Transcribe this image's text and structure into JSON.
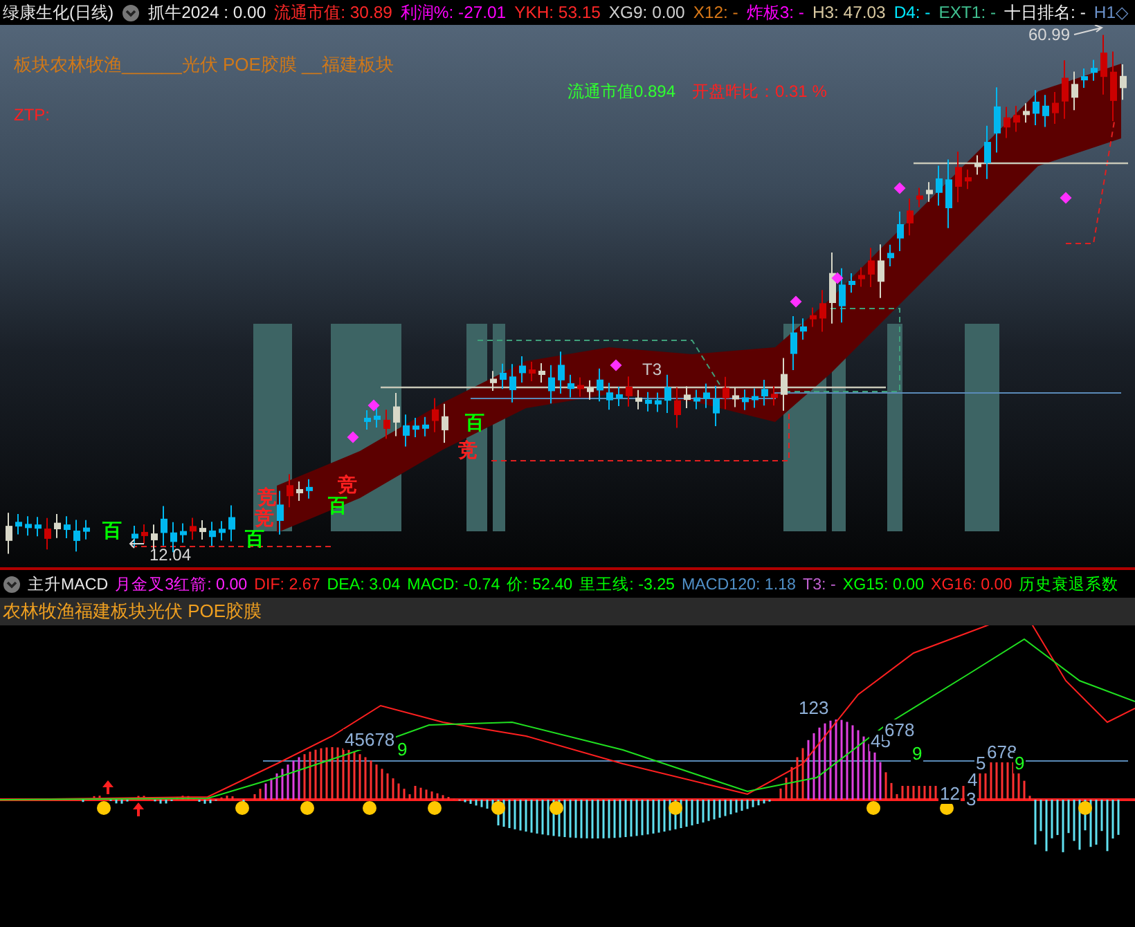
{
  "header": {
    "title": "绿康生化(日线)",
    "indicators": [
      {
        "text": "抓牛2024 : 0.00",
        "color": "#e8e8e8"
      },
      {
        "text": "流通市值: 30.89",
        "color": "#ff2828"
      },
      {
        "text": "利润%: -27.01",
        "color": "#ff00ff"
      },
      {
        "text": "YKH: 53.15",
        "color": "#ff2828"
      },
      {
        "text": "XG9: 0.00",
        "color": "#d0d0d0"
      },
      {
        "text": "X12: -",
        "color": "#d87818"
      },
      {
        "text": "炸板3: -",
        "color": "#ff00ff"
      },
      {
        "text": "H3: 47.03",
        "color": "#d8c8a0"
      },
      {
        "text": "D4: -",
        "color": "#00e8ff"
      },
      {
        "text": "EXT1: -",
        "color": "#40c090"
      },
      {
        "text": "十日排名: -",
        "color": "#f0f0f0"
      },
      {
        "text": "H1◇",
        "color": "#6a90c8"
      }
    ]
  },
  "price_chart": {
    "sector_text": "板块农林牧渔______光伏 POE胶膜 __福建板块",
    "ztp_text": "ZTP:",
    "float_cap": "流通市值0.894",
    "open_ratio": "开盘昨比：0.31 %",
    "high_label": "60.99",
    "low_label": "12.04",
    "t3_label": "T3",
    "markers": [
      {
        "text": "百",
        "color": "#00ff00"
      },
      {
        "text": "竞",
        "color": "#ff2020"
      },
      {
        "text": "竞",
        "color": "#ff2020"
      },
      {
        "text": "百",
        "color": "#00ff00"
      },
      {
        "text": "竞",
        "color": "#ff2020"
      },
      {
        "text": "百",
        "color": "#00ff00"
      },
      {
        "text": "竞",
        "color": "#ff2020"
      },
      {
        "text": "百",
        "color": "#00ff00"
      }
    ]
  },
  "macd_panel": {
    "title": "主升MACD",
    "indicators": [
      {
        "text": "月金叉3红箭: 0.00",
        "color": "#ff20ff"
      },
      {
        "text": "DIF: 2.67",
        "color": "#ff2020"
      },
      {
        "text": "DEA: 3.04",
        "color": "#00ff00"
      },
      {
        "text": "MACD: -0.74",
        "color": "#00ff00"
      },
      {
        "text": "价: 52.40",
        "color": "#00ff00"
      },
      {
        "text": "里王线: -3.25",
        "color": "#00ff00"
      },
      {
        "text": "MACD120: 1.18",
        "color": "#5090c8"
      },
      {
        "text": "T3: -",
        "color": "#c060d0"
      },
      {
        "text": "XG15: 0.00",
        "color": "#00ff00"
      },
      {
        "text": "XG16: 0.00",
        "color": "#ff2020"
      },
      {
        "text": "历史衰退系数",
        "color": "#00ff00"
      }
    ],
    "subtitle": "农林牧渔福建板块光伏 POE胶膜",
    "count_labels": [
      {
        "text": "45678",
        "color": "#8fb0d8"
      },
      {
        "text": "9",
        "color": "#20ff20"
      },
      {
        "text": "123",
        "color": "#8fb0d8"
      },
      {
        "text": "45",
        "color": "#8fb0d8"
      },
      {
        "text": "678",
        "color": "#8fb0d8"
      },
      {
        "text": "9",
        "color": "#20ff20"
      },
      {
        "text": "12",
        "color": "#8fb0d8"
      },
      {
        "text": "3",
        "color": "#8fb0d8"
      },
      {
        "text": "4",
        "color": "#8fb0d8"
      },
      {
        "text": "5",
        "color": "#8fb0d8"
      },
      {
        "text": "678",
        "color": "#8fb0d8"
      },
      {
        "text": "9",
        "color": "#20ff20"
      }
    ]
  }
}
